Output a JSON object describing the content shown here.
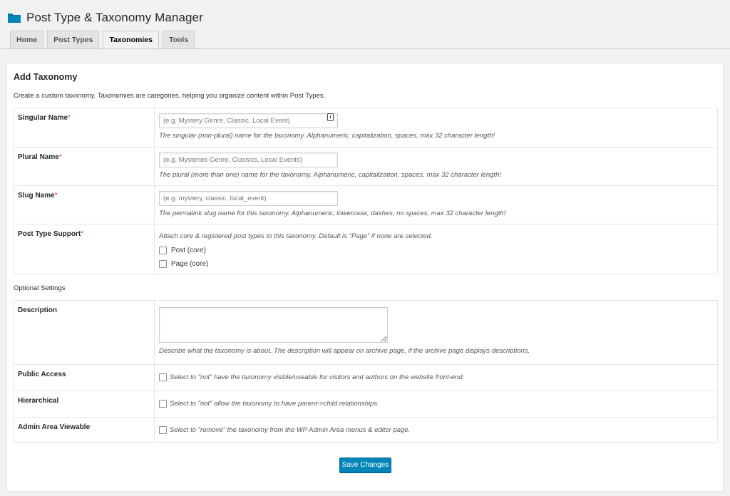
{
  "app": {
    "title": "Post Type & Taxonomy Manager",
    "icon": "folder-icon",
    "accent": "#0085ba"
  },
  "tabs": [
    {
      "label": "Home",
      "active": false
    },
    {
      "label": "Post Types",
      "active": false
    },
    {
      "label": "Taxonomies",
      "active": true
    },
    {
      "label": "Tools",
      "active": false
    }
  ],
  "form": {
    "heading": "Add Taxonomy",
    "intro": "Create a custom taxonomy. Taxonomies are categories, helping you organize content within Post Types.",
    "required_mark": "*",
    "singular": {
      "label": "Singular Name",
      "value": "",
      "placeholder": "(e.g. Mystery Genre, Classic, Local Event)",
      "help": "The singular (non-plural) name for the taxonomy. Alphanumeric, capitalization, spaces, max 32 character length!"
    },
    "plural": {
      "label": "Plural Name",
      "value": "",
      "placeholder": "(e.g. Mysteries Genre, Classics, Local Events)",
      "help": "The plural (more than one) name for the taxonomy. Alphanumeric, capitalization, spaces, max 32 character length!"
    },
    "slug": {
      "label": "Slug Name",
      "value": "",
      "placeholder": "(e.g. mystery, classic, local_event)",
      "help": "The permalink slug name for this taxonomy. Alphanumeric, lowercase, dashes, no spaces, max 32 character length!"
    },
    "post_type_support": {
      "label": "Post Type Support",
      "help": "Attach core & registered post types to this taxonomy. Default is \"Page\" if none are selected.",
      "options": [
        {
          "label": "Post (core)",
          "checked": false
        },
        {
          "label": "Page (core)",
          "checked": false
        }
      ]
    }
  },
  "optional": {
    "title": "Optional Settings",
    "description": {
      "label": "Description",
      "value": "",
      "help": "Describe what the taxonomy is about. The description will appear on archive page, if the archive page displays descriptions."
    },
    "public_access": {
      "label": "Public Access",
      "checked": false,
      "help": "Select to \"not\" have the taxonomy visible/useable for visitors and authors on the website front-end."
    },
    "hierarchical": {
      "label": "Hierarchical",
      "checked": false,
      "help": "Select to \"not\" allow the taxonomy to have parent->child relationships."
    },
    "admin_viewable": {
      "label": "Admin Area Viewable",
      "checked": false,
      "help": "Select to \"remove\" the taxonomy from the WP Admin Area menus & editor page."
    }
  },
  "save_label": "Save Changes"
}
